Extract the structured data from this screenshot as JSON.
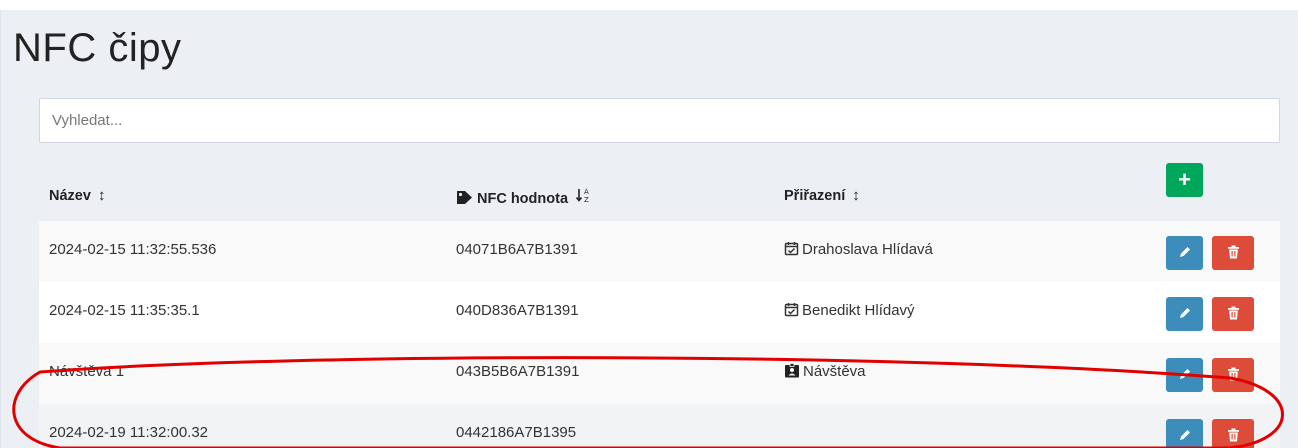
{
  "page": {
    "title": "NFC čipy"
  },
  "search": {
    "placeholder": "Vyhledat..."
  },
  "table": {
    "headers": {
      "name": "Název",
      "nfc": "NFC hodnota",
      "assignment": "Přiřazení"
    },
    "rows": [
      {
        "name": "2024-02-15 11:32:55.536",
        "nfc": "04071B6A7B1391",
        "assignment": "Drahoslava Hlídavá",
        "assignment_icon": "calendar-check-icon"
      },
      {
        "name": "2024-02-15 11:35:35.1",
        "nfc": "040D836A7B1391",
        "assignment": "Benedikt Hlídavý",
        "assignment_icon": "calendar-check-icon"
      },
      {
        "name": "Návštěva 1",
        "nfc": "043B5B6A7B1391",
        "assignment": "Návštěva",
        "assignment_icon": "id-badge-icon"
      },
      {
        "name": "2024-02-19 11:32:00.32",
        "nfc": "0442186A7B1395",
        "assignment": "",
        "assignment_icon": ""
      }
    ]
  },
  "colors": {
    "add": "#00a65a",
    "edit": "#3c8dbc",
    "delete": "#dd4b39",
    "annotation": "#e00000"
  }
}
